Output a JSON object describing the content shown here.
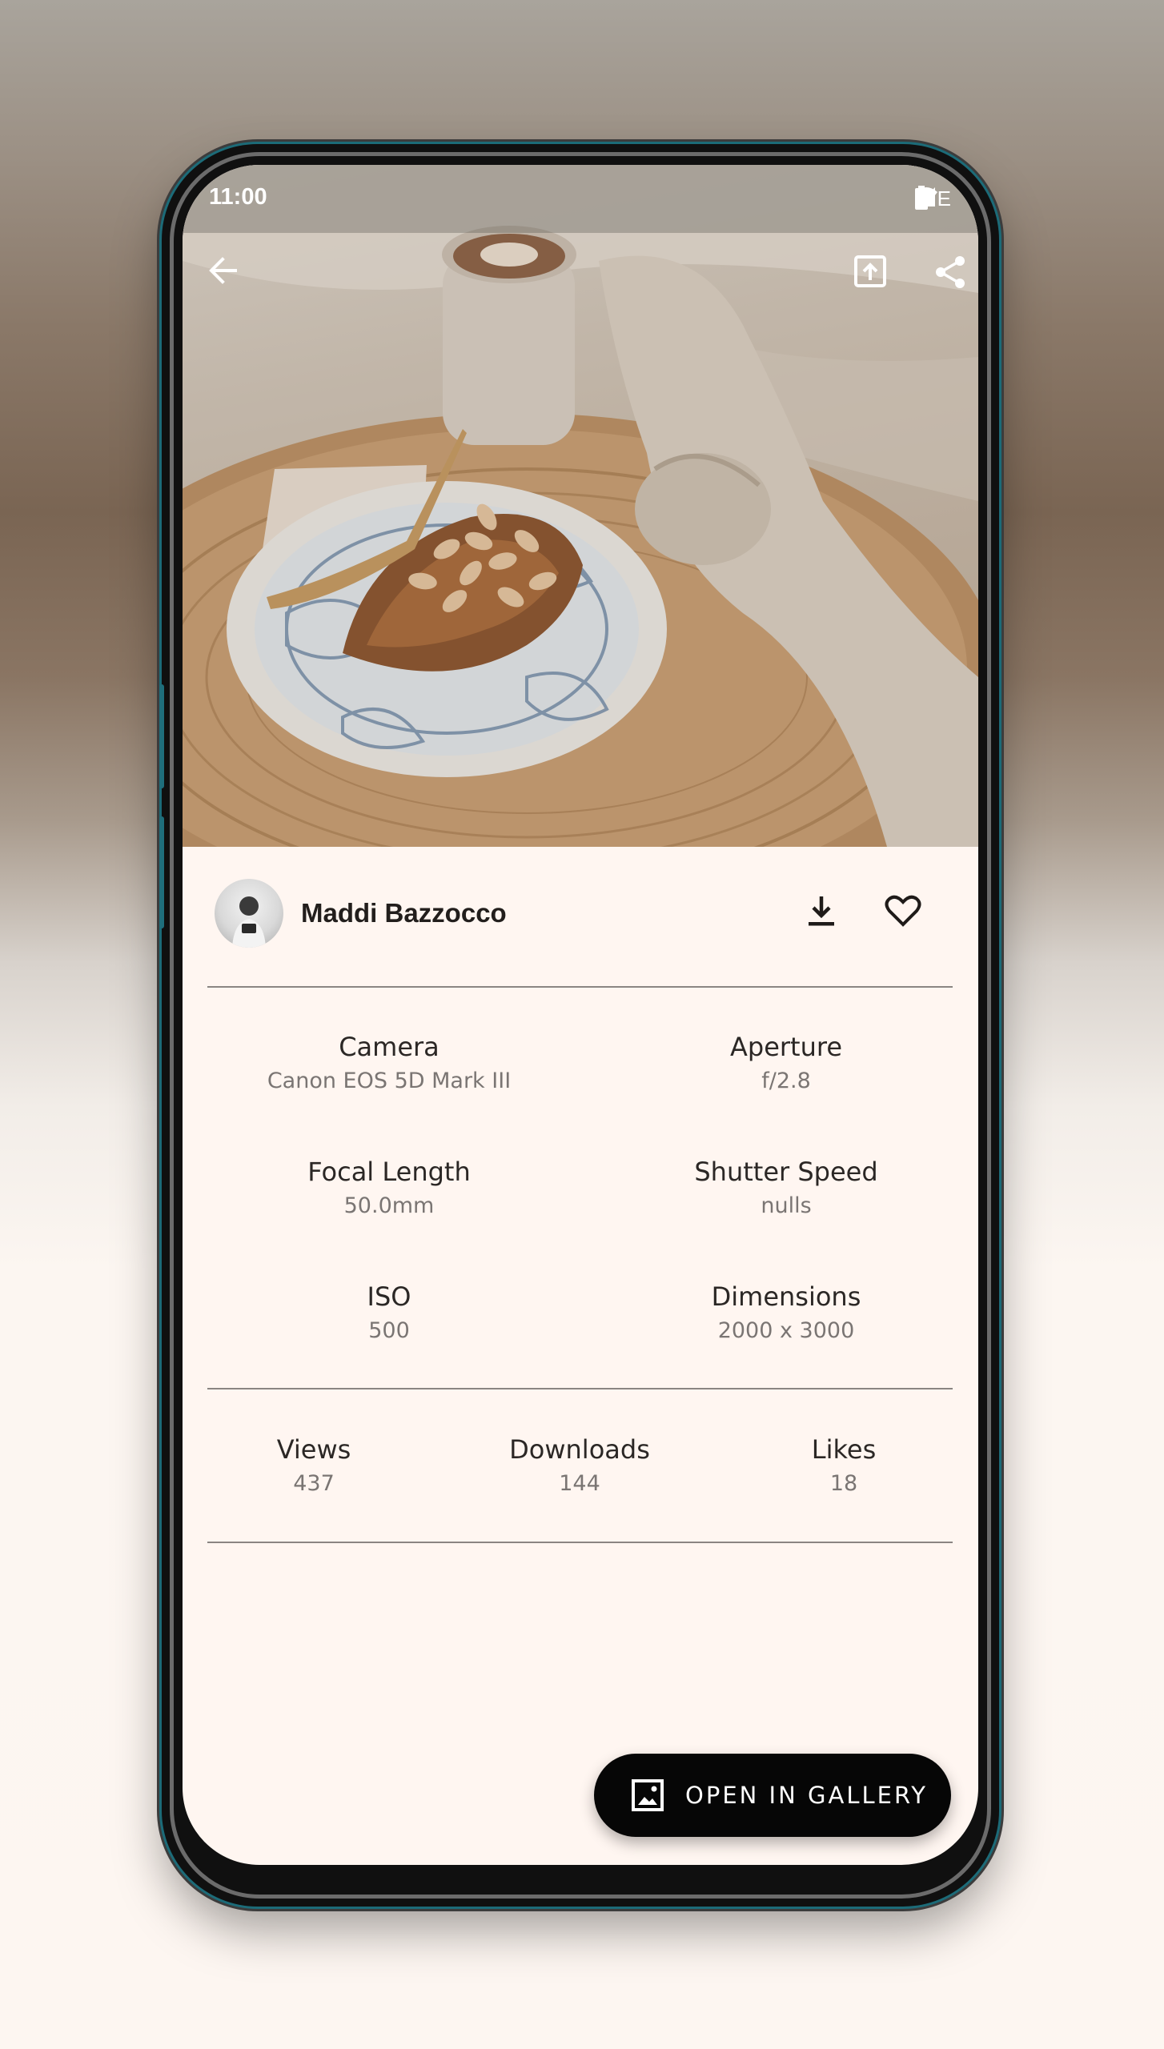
{
  "status_bar": {
    "time": "11:00",
    "network": "LTE",
    "icons": [
      "wifi-icon",
      "signal-icon",
      "battery-icon"
    ]
  },
  "toolbar": {
    "back_icon": "arrow-left-icon",
    "set_wallpaper_icon": "wallpaper-icon",
    "share_icon": "share-icon"
  },
  "author": {
    "name": "Maddi Bazzocco",
    "download_icon": "download-icon",
    "like_icon": "heart-icon"
  },
  "exif": [
    {
      "label": "Camera",
      "value": "Canon EOS 5D Mark III"
    },
    {
      "label": "Aperture",
      "value": "f/2.8"
    },
    {
      "label": "Focal Length",
      "value": "50.0mm"
    },
    {
      "label": "Shutter Speed",
      "value": "nulls"
    },
    {
      "label": "ISO",
      "value": "500"
    },
    {
      "label": "Dimensions",
      "value": "2000 x 3000"
    }
  ],
  "stats": [
    {
      "label": "Views",
      "value": "437"
    },
    {
      "label": "Downloads",
      "value": "144"
    },
    {
      "label": "Likes",
      "value": "18"
    }
  ],
  "fab": {
    "label": "OPEN IN GALLERY",
    "icon": "gallery-icon"
  },
  "colors": {
    "background": "#fff6f1",
    "fab": "#060606",
    "divider": "#8a8582"
  }
}
